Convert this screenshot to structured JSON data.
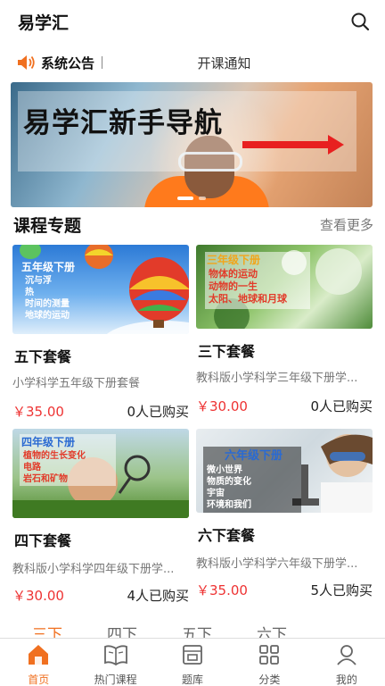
{
  "header": {
    "title": "易学汇"
  },
  "notice": {
    "label": "系统公告",
    "text": "开课通知"
  },
  "banner": {
    "title": "易学汇新手导航",
    "slide_count": 2,
    "active_slide": 1
  },
  "courses_section": {
    "title": "课程专题",
    "more": "查看更多"
  },
  "courses": [
    {
      "name": "五下套餐",
      "desc": "小学科学五年级下册套餐",
      "price": "￥35.00",
      "sold": "0人已购买",
      "thumb_title": "五年级下册",
      "thumb_items": [
        "沉与浮",
        "热",
        "时间的测量",
        "地球的运动"
      ]
    },
    {
      "name": "三下套餐",
      "desc": "教科版小学科学三年级下册学...",
      "price": "￥30.00",
      "sold": "0人已购买",
      "thumb_title": "三年级下册",
      "thumb_items": [
        "物体的运动",
        "动物的一生",
        "太阳、地球和月球"
      ]
    },
    {
      "name": "四下套餐",
      "desc": "教科版小学科学四年级下册学...",
      "price": "￥30.00",
      "sold": "4人已购买",
      "thumb_title": "四年级下册",
      "thumb_items": [
        "植物的生长变化",
        "电路",
        "岩石和矿物"
      ]
    },
    {
      "name": "六下套餐",
      "desc": "教科版小学科学六年级下册学...",
      "price": "￥35.00",
      "sold": "5人已购买",
      "thumb_title": "六年级下册",
      "thumb_items": [
        "微小世界",
        "物质的变化",
        "宇宙",
        "环境和我们"
      ]
    }
  ],
  "tabs": [
    "三下",
    "四下",
    "五下",
    "六下"
  ],
  "active_tab": 0,
  "bottom_nav": [
    {
      "label": "首页",
      "icon": "home-icon"
    },
    {
      "label": "热门课程",
      "icon": "book-icon"
    },
    {
      "label": "题库",
      "icon": "question-bank-icon"
    },
    {
      "label": "分类",
      "icon": "category-icon"
    },
    {
      "label": "我的",
      "icon": "user-icon"
    }
  ],
  "colors": {
    "accent": "#f07020",
    "price": "#e33333"
  }
}
